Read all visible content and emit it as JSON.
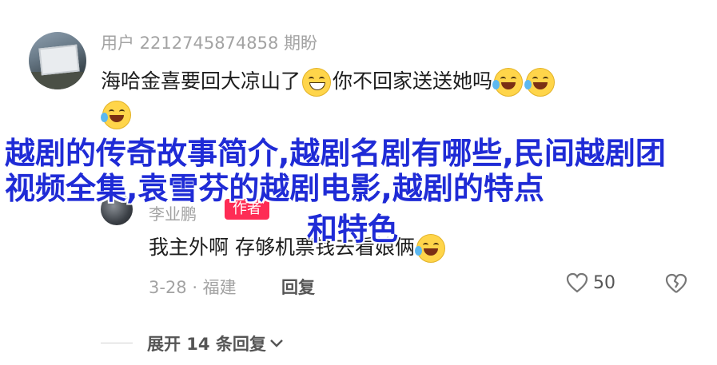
{
  "comment": {
    "username": "用户 2212745874858 期盼",
    "text_part1": "海哈金喜要回大凉山了",
    "text_part2": "你不回家送送她吗"
  },
  "watermark": {
    "line1": "越剧的传奇故事简介,越剧名剧有哪些,民间越剧团视频全集,袁雪芬的越剧电影,越剧的特点",
    "line2": "和特色"
  },
  "reply": {
    "username": "李业鹏",
    "badge": "作者",
    "text": "我主外啊 存够机票钱去看娘俩",
    "date_location": "3-28 · 福建",
    "reply_label": "回复",
    "like_count": "50"
  },
  "expand": {
    "label": "展开 14 条回复"
  },
  "colors": {
    "accent_badge": "#fe2c55",
    "watermark": "#1f2bd6",
    "meta_text": "#a3a3a3"
  }
}
